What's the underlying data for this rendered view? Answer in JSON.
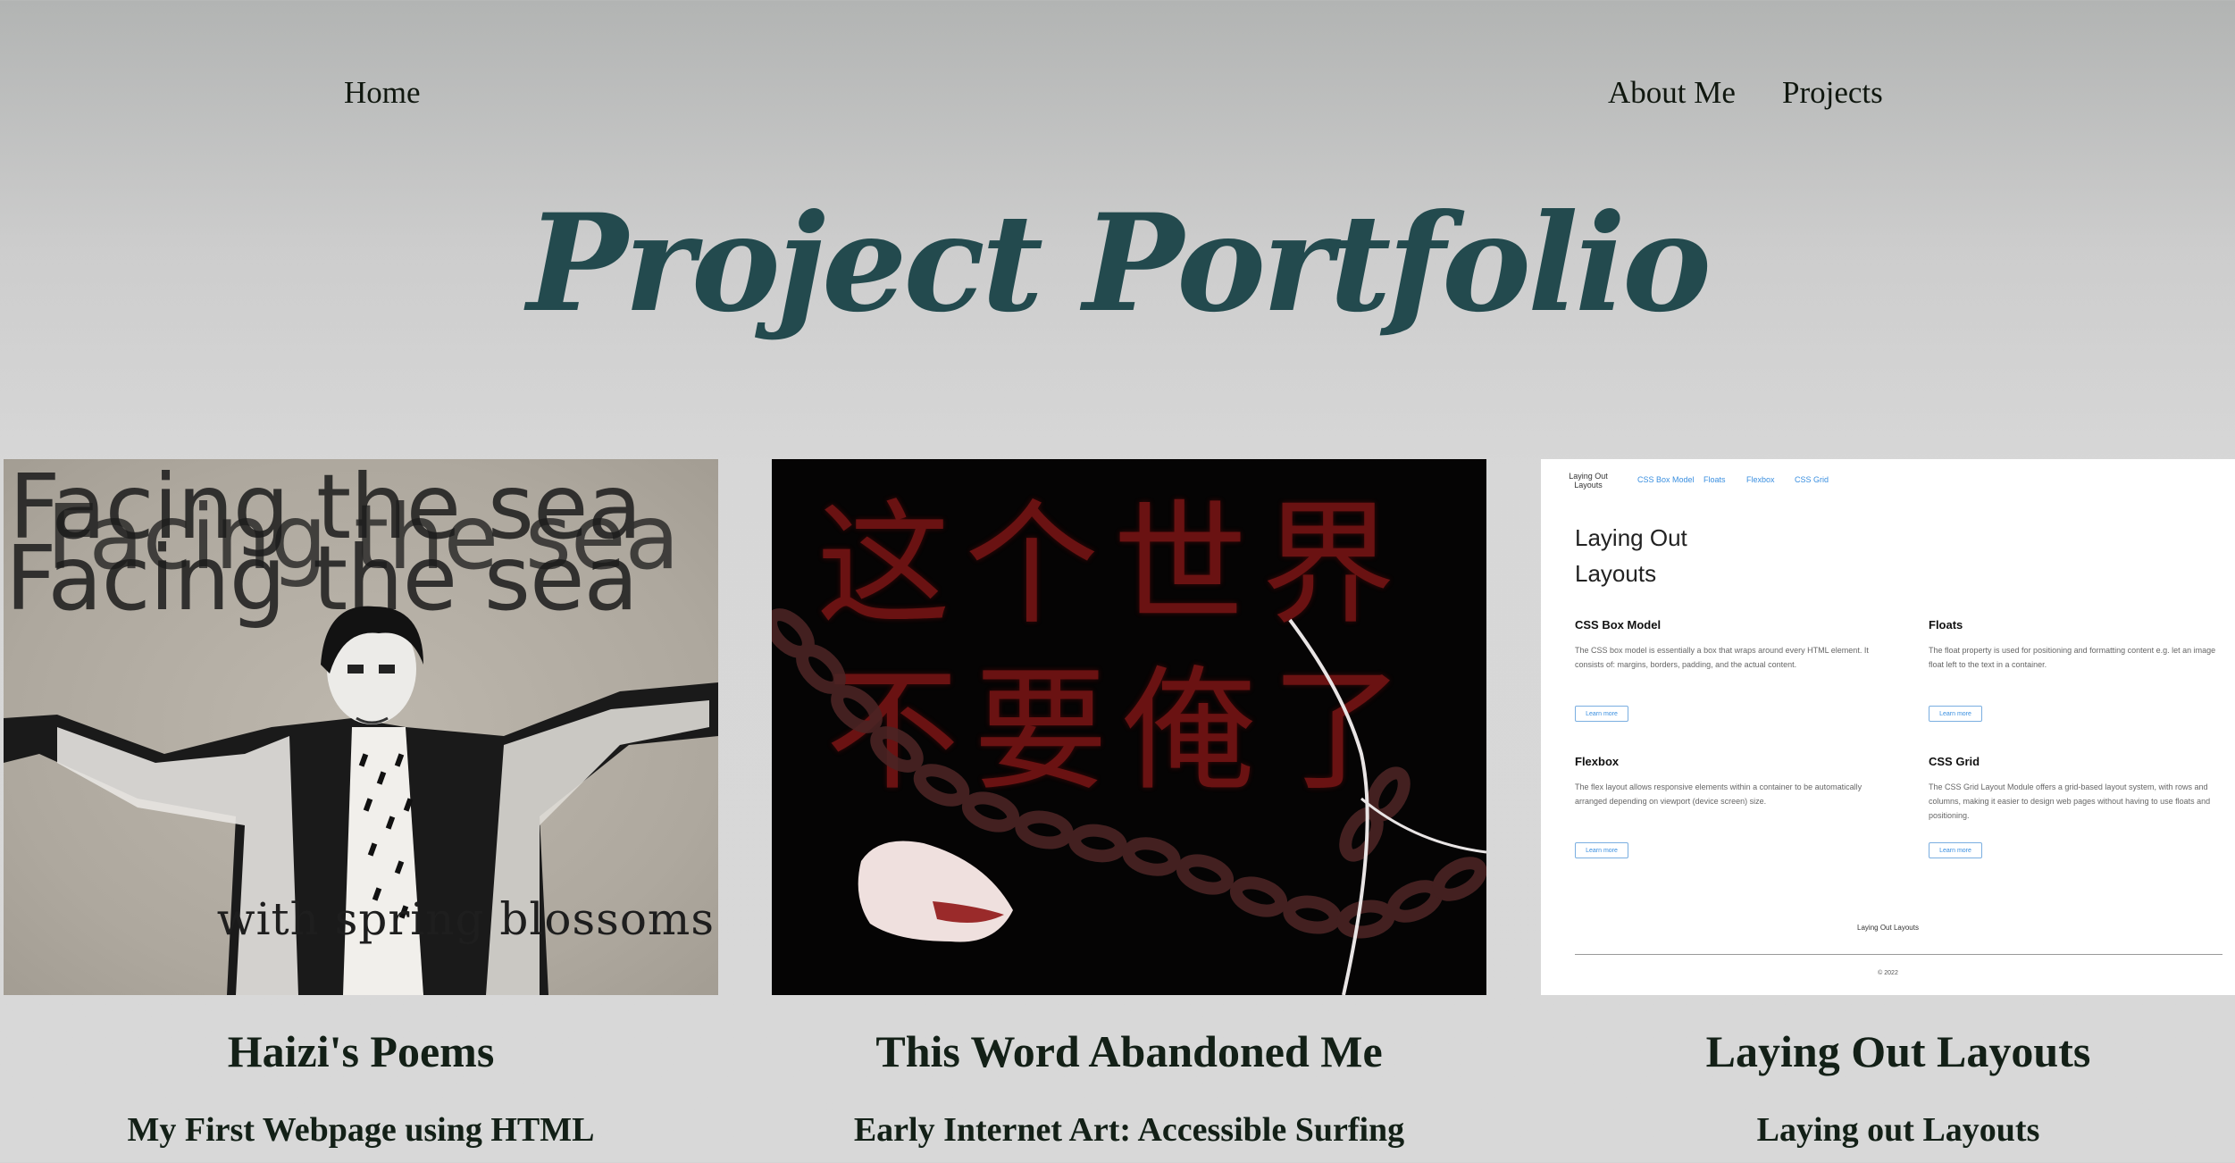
{
  "nav": {
    "home": "Home",
    "about": "About Me",
    "projects": "Projects"
  },
  "header": {
    "title": "Project Portfolio"
  },
  "colors": {
    "title": "#234a4e",
    "background": "#d7d7d7",
    "text": "#132017"
  },
  "projects": [
    {
      "title": "Haizi's Poems",
      "subtitle": "My First Webpage using HTML",
      "thumb": {
        "line1": "Facing the sea",
        "line2": "Facing the sea",
        "line3": "Facing the sea",
        "bottom": "with spring blossoms"
      }
    },
    {
      "title": "This Word Abandoned Me",
      "subtitle": "Early Internet Art: Accessible Surfing",
      "thumb": {
        "line1": "这个世界",
        "line2": "不要俺了"
      }
    },
    {
      "title": "Laying Out Layouts",
      "subtitle": "Laying out Layouts",
      "thumb": {
        "brand": "Laying Out Layouts",
        "links": [
          "CSS Box Model",
          "Floats",
          "Flexbox",
          "CSS Grid"
        ],
        "title": "Laying Out Layouts",
        "sections": [
          {
            "heading": "CSS Box Model",
            "text": "The CSS box model is essentially a box that wraps around every HTML element. It consists of: margins, borders, padding, and the actual content.",
            "button": "Learn more"
          },
          {
            "heading": "Floats",
            "text": "The float property is used for positioning and formatting content e.g. let an image float left to the text in a container.",
            "button": "Learn more"
          },
          {
            "heading": "Flexbox",
            "text": "The flex layout allows responsive elements within a container to be automatically arranged depending on viewport (device screen) size.",
            "button": "Learn more"
          },
          {
            "heading": "CSS Grid",
            "text": "The CSS Grid Layout Module offers a grid-based layout system, with rows and columns, making it easier to design web pages without having to use floats and positioning.",
            "button": "Learn more"
          }
        ],
        "footer": "Laying Out Layouts",
        "copyright": "© 2022"
      }
    }
  ]
}
